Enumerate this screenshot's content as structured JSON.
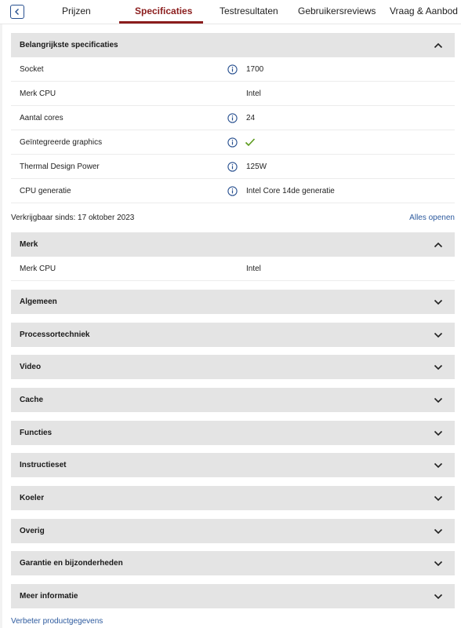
{
  "tabs": [
    {
      "label": "Prijzen"
    },
    {
      "label": "Specificaties"
    },
    {
      "label": "Testresultaten"
    },
    {
      "label": "Gebruikersreviews"
    },
    {
      "label": "Vraag & Aanbod"
    }
  ],
  "active_tab": "Specificaties",
  "colors": {
    "accent": "#8b1d1d",
    "link": "#2d5a9e",
    "check": "#5a9a1a",
    "header_bg": "#e4e4e4"
  },
  "key_specs": {
    "title": "Belangrijkste specificaties",
    "rows": [
      {
        "label": "Socket",
        "value": "1700",
        "info": true
      },
      {
        "label": "Merk CPU",
        "value": "Intel",
        "info": false
      },
      {
        "label": "Aantal cores",
        "value": "24",
        "info": true
      },
      {
        "label": "Geïntegreerde graphics",
        "value": "",
        "info": true,
        "check": true
      },
      {
        "label": "Thermal Design Power",
        "value": "125W",
        "info": true
      },
      {
        "label": "CPU generatie",
        "value": "Intel Core 14de generatie",
        "info": true
      }
    ]
  },
  "availability": "Verkrijgbaar sinds: 17 oktober 2023",
  "open_all": "Alles openen",
  "brand_section": {
    "title": "Merk",
    "rows": [
      {
        "label": "Merk CPU",
        "value": "Intel"
      }
    ]
  },
  "collapsed_sections": [
    "Algemeen",
    "Processortechniek",
    "Video",
    "Cache",
    "Functies",
    "Instructieset",
    "Koeler",
    "Overig",
    "Garantie en bijzonderheden",
    "Meer informatie"
  ],
  "improve_link": "Verbeter productgegevens"
}
